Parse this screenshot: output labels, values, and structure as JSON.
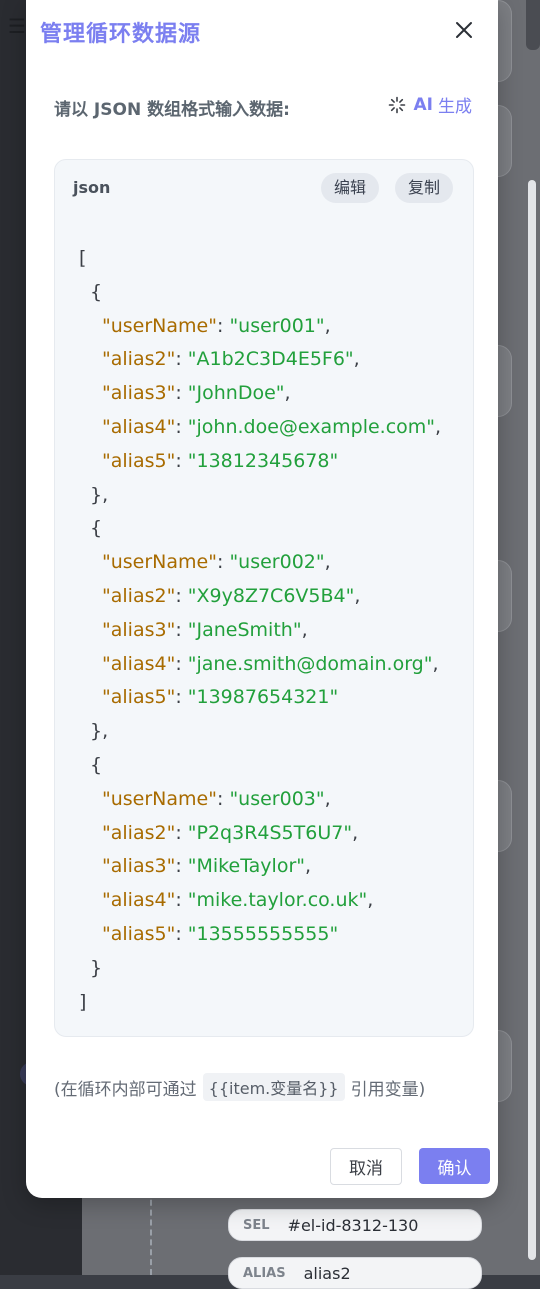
{
  "modal": {
    "title": "管理循环数据源",
    "prompt": "请以 JSON 数组格式输入数据:",
    "ai_label_ai": "AI",
    "ai_label_text": "生成",
    "code_lang": "json",
    "edit_label": "编辑",
    "copy_label": "复制",
    "hint_prefix": "(在循环内部可通过",
    "hint_template": "{{item.变量名}}",
    "hint_suffix": "引用变量)",
    "cancel_label": "取消",
    "confirm_label": "确认"
  },
  "json_lines": [
    {
      "indent": 0,
      "text": "["
    },
    {
      "indent": 1,
      "text": "{"
    },
    {
      "indent": 2,
      "key": "userName",
      "value": "user001",
      "comma": true
    },
    {
      "indent": 2,
      "key": "alias2",
      "value": "A1b2C3D4E5F6",
      "comma": true
    },
    {
      "indent": 2,
      "key": "alias3",
      "value": "JohnDoe",
      "comma": true
    },
    {
      "indent": 2,
      "key": "alias4",
      "value": "john.doe@example.com",
      "comma": true
    },
    {
      "indent": 2,
      "key": "alias5",
      "value": "13812345678",
      "comma": false
    },
    {
      "indent": 1,
      "text": "},"
    },
    {
      "indent": 1,
      "text": "{"
    },
    {
      "indent": 2,
      "key": "userName",
      "value": "user002",
      "comma": true
    },
    {
      "indent": 2,
      "key": "alias2",
      "value": "X9y8Z7C6V5B4",
      "comma": true
    },
    {
      "indent": 2,
      "key": "alias3",
      "value": "JaneSmith",
      "comma": true
    },
    {
      "indent": 2,
      "key": "alias4",
      "value": "jane.smith@domain.org",
      "comma": true
    },
    {
      "indent": 2,
      "key": "alias5",
      "value": "13987654321",
      "comma": false
    },
    {
      "indent": 1,
      "text": "},"
    },
    {
      "indent": 1,
      "text": "{"
    },
    {
      "indent": 2,
      "key": "userName",
      "value": "user003",
      "comma": true
    },
    {
      "indent": 2,
      "key": "alias2",
      "value": "P2q3R4S5T6U7",
      "comma": true
    },
    {
      "indent": 2,
      "key": "alias3",
      "value": "MikeTaylor",
      "comma": true
    },
    {
      "indent": 2,
      "key": "alias4",
      "value": "mike.taylor.co.uk",
      "comma": true
    },
    {
      "indent": 2,
      "key": "alias5",
      "value": "13555555555",
      "comma": false
    },
    {
      "indent": 1,
      "text": "}"
    },
    {
      "indent": 0,
      "text": "]"
    }
  ],
  "background": {
    "sel_tag": "SEL",
    "sel_value": "#el-id-8312-130",
    "alias_tag": "ALIAS",
    "alias_value": "alias2"
  },
  "colors": {
    "accent": "#7b7ff0",
    "json_key": "#a86b00",
    "json_string": "#22a03c"
  }
}
